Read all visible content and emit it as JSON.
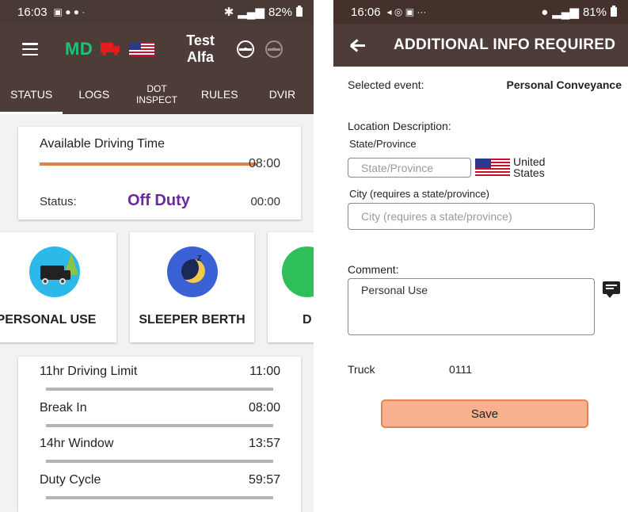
{
  "left": {
    "statusbar": {
      "time": "16:03",
      "battery": "82%"
    },
    "appbar": {
      "md_label": "MD",
      "title_line1": "Test",
      "title_line2": "Alfa"
    },
    "tabs": [
      {
        "label": "STATUS",
        "active": true
      },
      {
        "label": "LOGS"
      },
      {
        "label": "DOT\nINSPECT"
      },
      {
        "label": "RULES"
      },
      {
        "label": "DVIR"
      }
    ],
    "available": {
      "title": "Available Driving Time",
      "time": "08:00",
      "status_label": "Status:",
      "status_value": "Off Duty",
      "status_time": "00:00"
    },
    "duty_status": [
      {
        "label": "PERSONAL USE",
        "icon": "personal-use-icon"
      },
      {
        "label": "SLEEPER BERTH",
        "icon": "sleeper-berth-icon"
      },
      {
        "label": "D",
        "icon": "driving-icon"
      }
    ],
    "limits": [
      {
        "name": "11hr Driving Limit",
        "value": "11:00"
      },
      {
        "name": "Break In",
        "value": "08:00"
      },
      {
        "name": "14hr Window",
        "value": "13:57"
      },
      {
        "name": "Duty Cycle",
        "value": "59:57"
      }
    ]
  },
  "right": {
    "statusbar": {
      "time": "16:06",
      "battery": "81%"
    },
    "title": "ADDITIONAL INFO REQUIRED",
    "selected_event_label": "Selected event:",
    "selected_event_value": "Personal Conveyance",
    "location_label": "Location Description:",
    "state_label": "State/Province",
    "state_placeholder": "State/Province",
    "country_line1": "United",
    "country_line2": "States",
    "city_label": "City (requires a state/province)",
    "city_placeholder": "City (requires a state/province)",
    "comment_label": "Comment:",
    "comment_value": "Personal Use",
    "truck_label": "Truck",
    "truck_value": "0111",
    "save_label": "Save"
  },
  "colors": {
    "header": "#4d3c37",
    "orange_bar": "#e67e3e",
    "off_duty": "#6a2a9c",
    "save_button": "#f9b08f"
  }
}
